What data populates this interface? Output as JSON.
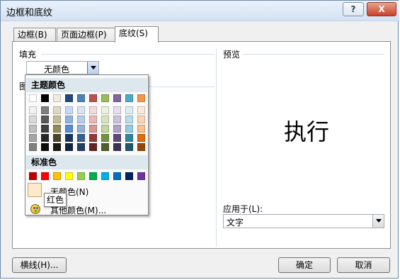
{
  "window": {
    "title": "边框和底纹",
    "help_label": "?",
    "close_label": "X"
  },
  "tabs": [
    {
      "label": "边框(B)",
      "active": false
    },
    {
      "label": "页面边框(P)",
      "active": false
    },
    {
      "label": "底纹(S)",
      "active": true
    }
  ],
  "fill": {
    "section_label": "填充",
    "value": "无颜色"
  },
  "pattern": {
    "section_label_partial": "图"
  },
  "preview": {
    "section_label": "预览",
    "sample_text": "执行"
  },
  "apply_to": {
    "label": "应用于(L):",
    "value": "文字"
  },
  "buttons": {
    "horizontal_line": "横线(H)...",
    "ok": "确定",
    "cancel": "取消"
  },
  "popup": {
    "theme_title": "主题颜色",
    "standard_title": "标准色",
    "no_color_label": "无颜色(N)",
    "more_colors_label": "其他颜色(M)...",
    "tooltip": "红色",
    "theme_columns": [
      [
        "#ffffff",
        "#f2f2f2",
        "#d9d9d9",
        "#bfbfbf",
        "#a6a6a6",
        "#808080"
      ],
      [
        "#000000",
        "#7f7f7f",
        "#595959",
        "#404040",
        "#262626",
        "#0d0d0d"
      ],
      [
        "#eeece1",
        "#ddd9c3",
        "#c4bd97",
        "#948a54",
        "#4a452a",
        "#1d1b10"
      ],
      [
        "#1f497d",
        "#c6d9f1",
        "#8db3e2",
        "#548dd4",
        "#17365d",
        "#0f243e"
      ],
      [
        "#4f81bd",
        "#dbe5f1",
        "#b8cce4",
        "#95b3d7",
        "#366092",
        "#244061"
      ],
      [
        "#c0504d",
        "#f2dcdb",
        "#e6b9b8",
        "#d99694",
        "#953734",
        "#632423"
      ],
      [
        "#9bbb59",
        "#ebf1dd",
        "#d7e3bc",
        "#c3d69b",
        "#76923c",
        "#4f6128"
      ],
      [
        "#8064a2",
        "#e5e0ec",
        "#ccc1d9",
        "#b2a2c7",
        "#5f497a",
        "#3f3151"
      ],
      [
        "#4bacc6",
        "#dbeef3",
        "#b7dde8",
        "#92cddc",
        "#31859b",
        "#205867"
      ],
      [
        "#f79646",
        "#fdeada",
        "#fbd5b5",
        "#fac08f",
        "#e36c09",
        "#974806"
      ]
    ],
    "standard_colors": [
      "#c00000",
      "#ff0000",
      "#ffc000",
      "#ffff00",
      "#92d050",
      "#00b050",
      "#00b0f0",
      "#0070c0",
      "#002060",
      "#7030a0"
    ]
  }
}
